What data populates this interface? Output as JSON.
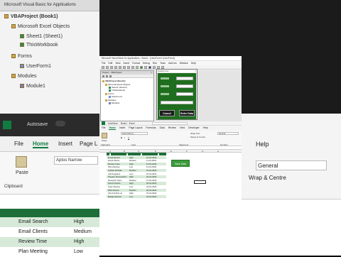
{
  "bg": {
    "vbe_title": "Microsoft Visual Basic for Applications",
    "tree": [
      "VBAProject (Book1)",
      "Microsoft Excel Objects",
      "Sheet1 (Sheet1)",
      "ThisWorkbook",
      "Forms",
      "UserForm1",
      "Modules",
      "Module1"
    ],
    "excel": {
      "autosave": "Autosave",
      "file_tab": "File",
      "home_tab": "Home",
      "insert_tab": "Insert",
      "page_tab": "Page L",
      "paste": "Paste",
      "clipboard": "Clipboard",
      "font_name": "Aptos Narrow",
      "rows": [
        {
          "name": "Email Search",
          "priority": "High"
        },
        {
          "name": "Email Clients",
          "priority": "Medium"
        },
        {
          "name": "Review Time",
          "priority": "High"
        },
        {
          "name": "Plan Meeting",
          "priority": "Low"
        }
      ]
    },
    "right": {
      "help": "Help",
      "general": "General",
      "wrap": "Wrap & Centre"
    }
  },
  "vbe": {
    "title": "Microsoft Visual Basic for Applications - Book1 - [UserForm1 (UserForm)]",
    "menu": [
      "File",
      "Edit",
      "View",
      "Insert",
      "Format",
      "Debug",
      "Run",
      "Tools",
      "Add-Ins",
      "Window",
      "Help"
    ],
    "project_panel_title": "Project - VBAProject",
    "tree": [
      "VBAProject (Book1)",
      "Microsoft Excel Objects",
      "Sheet1 (Sheet1)",
      "ThisWorkbook",
      "Forms",
      "UserForm1",
      "Modules",
      "Module1"
    ],
    "userform": {
      "title": "UserForm1",
      "cancel": "Cancel",
      "enter": "Enter Data"
    }
  },
  "excel": {
    "title": "Book1 - Excel",
    "autosave": "AutoSave",
    "tabs": [
      "File",
      "Home",
      "Insert",
      "Page Layout",
      "Formulas",
      "Data",
      "Review",
      "View",
      "Developer",
      "Help"
    ],
    "ribbon": {
      "paste": "Paste",
      "font": "Aptos Narrow",
      "wrap": "Wrap Text",
      "merge": "Merge & Centre",
      "number": "General",
      "clipboard": "Clipboard",
      "font_group": "Font",
      "alignment": "Alignment",
      "number_group": "Number"
    },
    "columns": [
      "A",
      "B",
      "C",
      "D",
      "E",
      "F",
      "G",
      "H"
    ],
    "rows": [
      {
        "task": "Email Search",
        "priority": "High",
        "date": "10-01-2024"
      },
      {
        "task": "Email Clients",
        "priority": "Medium",
        "date": "11-01-2024"
      },
      {
        "task": "Review Code",
        "priority": "High",
        "date": "12-01-2024"
      },
      {
        "task": "Plan Meeting",
        "priority": "Low",
        "date": "13-01-2024"
      },
      {
        "task": "Update Website",
        "priority": "Medium",
        "date": "14-01-2024"
      },
      {
        "task": "Call Suppliers",
        "priority": "Low",
        "date": "15-01-2024"
      },
      {
        "task": "Prepare Presentation",
        "priority": "High",
        "date": "16-01-2024"
      },
      {
        "task": "Research Topic",
        "priority": "Medium",
        "date": "17-01-2024"
      },
      {
        "task": "Send Invoices",
        "priority": "High",
        "date": "18-01-2024"
      },
      {
        "task": "Team Review",
        "priority": "Low",
        "date": "19-01-2024"
      },
      {
        "task": "Write Report",
        "priority": "Medium",
        "date": "20-01-2024"
      },
      {
        "task": "Client Follow-up",
        "priority": "High",
        "date": "21-01-2024"
      },
      {
        "task": "Budget Review",
        "priority": "Low",
        "date": "22-01-2024"
      }
    ],
    "save_button": "Save Data"
  },
  "colors": {
    "excel_green": "#107c41",
    "form_green": "#1f6e1f",
    "button_green": "#3c9a3c",
    "table_header": "#1e6e3a"
  }
}
